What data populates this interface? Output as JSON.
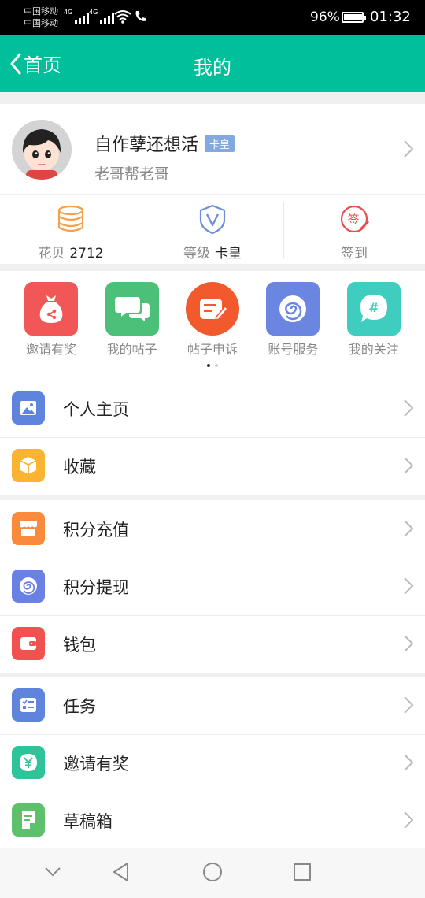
{
  "status_bar": {
    "carrier1": "中国移动",
    "carrier2": "中国移动",
    "signal1_label": "4G",
    "signal2_label": "4G",
    "battery_percent": "96%",
    "battery_level": 0.96,
    "time": "01:32"
  },
  "header": {
    "back_label": "首页",
    "title": "我的",
    "color": "#00bf9a"
  },
  "profile": {
    "nickname": "自作孽还想活",
    "badge": "卡皇",
    "subname": "老哥帮老哥"
  },
  "stats": [
    {
      "icon": "coins-icon",
      "label": "花贝",
      "value": "2712"
    },
    {
      "icon": "shield-v-icon",
      "label": "等级",
      "value": "卡皇"
    },
    {
      "icon": "sign-in-icon",
      "label": "签到",
      "value": ""
    }
  ],
  "grid": [
    {
      "icon": "money-bag-icon",
      "label": "邀请有奖",
      "color": "#f25757"
    },
    {
      "icon": "chat-bubbles-icon",
      "label": "我的帖子",
      "color": "#4cbf79"
    },
    {
      "icon": "edit-note-icon",
      "label": "帖子申诉",
      "color": "#f25a2e"
    },
    {
      "icon": "spiral-icon",
      "label": "账号服务",
      "color": "#6b86e0"
    },
    {
      "icon": "hashtag-bubble-icon",
      "label": "我的关注",
      "color": "#3fcdc0"
    }
  ],
  "menu_group1": [
    {
      "icon": "image-icon",
      "label": "个人主页",
      "color": "#5f84dd"
    },
    {
      "icon": "box-icon",
      "label": "收藏",
      "color": "#fbb332"
    }
  ],
  "menu_group2": [
    {
      "icon": "shop-icon",
      "label": "积分充值",
      "color": "#fa8b3c"
    },
    {
      "icon": "spiral-icon",
      "label": "积分提现",
      "color": "#6a80e2"
    },
    {
      "icon": "wallet-icon",
      "label": "钱包",
      "color": "#f2524f"
    }
  ],
  "menu_group3": [
    {
      "icon": "task-list-icon",
      "label": "任务",
      "color": "#5f84dd"
    },
    {
      "icon": "yen-icon",
      "label": "邀请有奖",
      "color": "#2fc39a"
    },
    {
      "icon": "draft-icon",
      "label": "草稿箱",
      "color": "#5ec06a"
    }
  ]
}
